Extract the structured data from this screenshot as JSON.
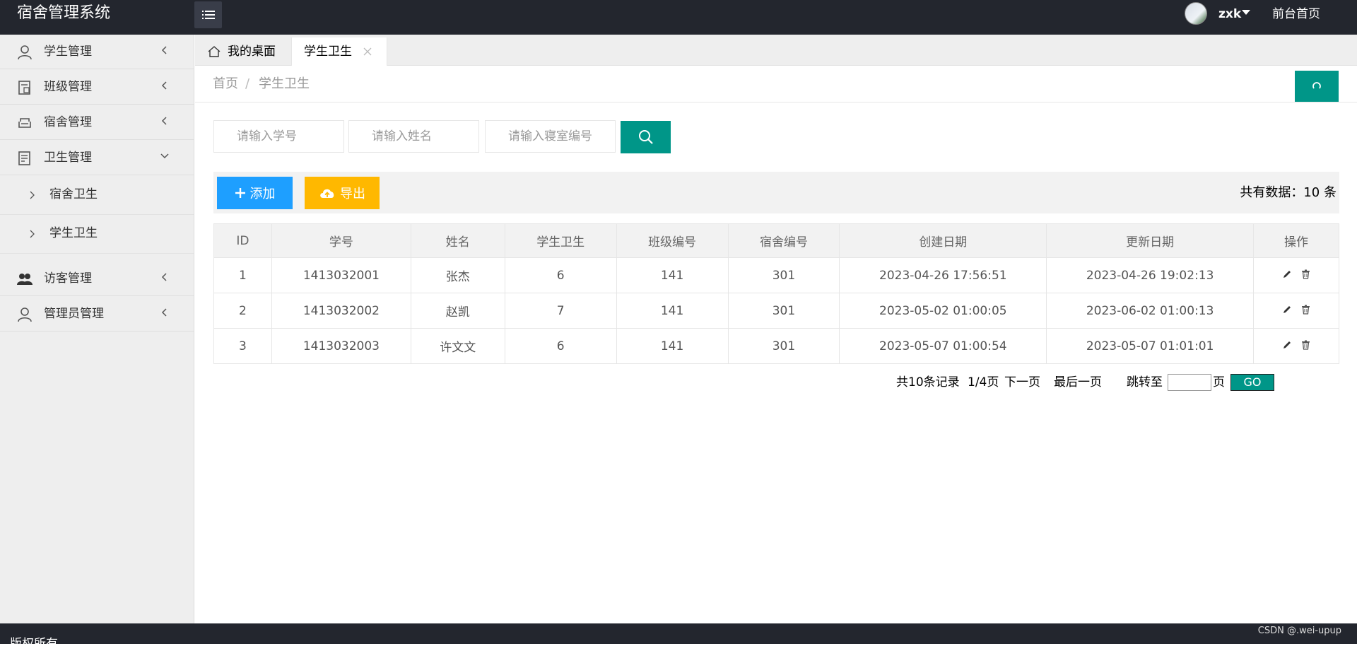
{
  "app": {
    "title": "宿舍管理系统"
  },
  "header": {
    "username": "zxk",
    "front_link": "前台首页"
  },
  "sidebar": {
    "items": [
      {
        "label": "学生管理",
        "icon": "user-icon"
      },
      {
        "label": "班级管理",
        "icon": "class-icon"
      },
      {
        "label": "宿舍管理",
        "icon": "sofa-icon"
      },
      {
        "label": "卫生管理",
        "icon": "notepad-icon",
        "expanded": true,
        "children": [
          {
            "label": "宿舍卫生"
          },
          {
            "label": "学生卫生"
          }
        ]
      },
      {
        "label": "访客管理",
        "icon": "group-icon"
      },
      {
        "label": "管理员管理",
        "icon": "user-icon"
      }
    ]
  },
  "tabs": [
    {
      "label": "我的桌面",
      "icon": "home-icon"
    },
    {
      "label": "学生卫生",
      "active": true
    }
  ],
  "breadcrumb": {
    "home": "首页",
    "separator": "/",
    "current": "学生卫生"
  },
  "search": {
    "student_id_placeholder": "请输入学号",
    "name_placeholder": "请输入姓名",
    "room_placeholder": "请输入寝室编号"
  },
  "toolbar": {
    "add_label": "添加",
    "export_label": "导出",
    "total_label": "共有数据：10 条"
  },
  "table": {
    "columns": [
      "ID",
      "学号",
      "姓名",
      "学生卫生",
      "班级编号",
      "宿舍编号",
      "创建日期",
      "更新日期",
      "操作"
    ],
    "rows": [
      [
        "1",
        "1413032001",
        "张杰",
        "6",
        "141",
        "301",
        "2023-04-26 17:56:51",
        "2023-04-26 19:02:13"
      ],
      [
        "2",
        "1413032002",
        "赵凯",
        "7",
        "141",
        "301",
        "2023-05-02 01:00:05",
        "2023-06-02 01:00:13"
      ],
      [
        "3",
        "1413032003",
        "许文文",
        "6",
        "141",
        "301",
        "2023-05-07 01:00:54",
        "2023-05-07 01:01:01"
      ]
    ]
  },
  "pagination": {
    "total": "共10条记录",
    "page": "1/4页",
    "next": "下一页",
    "last": "最后一页",
    "jump_to": "跳转至",
    "page_unit": "页",
    "go": "GO"
  },
  "footer": {
    "copyright": "版权所有",
    "credit": "CSDN @.wei-upup"
  },
  "colors": {
    "header_bg": "#23262e",
    "primary_teal": "#009688",
    "blue": "#1e9fff",
    "orange": "#ffb800",
    "sidebar_bg": "#eeeeee"
  }
}
